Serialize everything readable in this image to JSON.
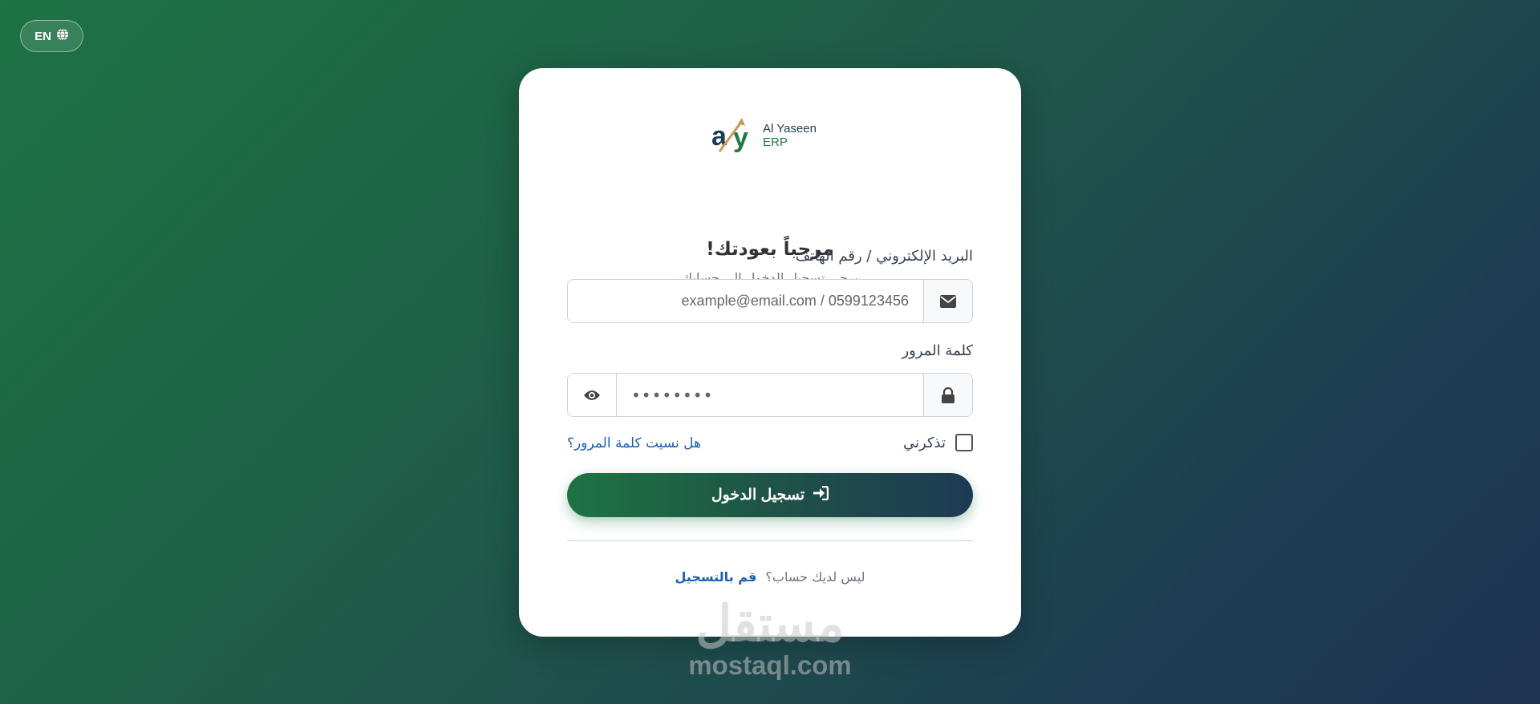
{
  "language_toggle": {
    "label": "EN",
    "icon": "globe-icon"
  },
  "logo": {
    "line1": "Al Yaseen",
    "line2": "ERP",
    "icon": "aly-logo-mark"
  },
  "header": {
    "title": "مرحباً بعودتك!",
    "subtitle": "يرجى تسجيل الدخول إلى حسابك"
  },
  "email_field": {
    "label": "البريد الإلكتروني / رقم الهاتف",
    "placeholder": "example@email.com / 0599123456",
    "icon": "envelope-icon"
  },
  "password_field": {
    "label": "كلمة المرور",
    "value_masked": "••••••••",
    "lock_icon": "lock-icon",
    "toggle_icon": "eye-icon"
  },
  "remember_me": {
    "label": "تذكرني",
    "checked": false
  },
  "forgot_password": {
    "label": "هل نسيت كلمة المرور؟"
  },
  "login_button": {
    "label": "تسجيل الدخول",
    "icon": "sign-in-icon"
  },
  "signup": {
    "prompt": "ليس لديك حساب؟",
    "link": "قم بالتسجيل"
  },
  "watermark": {
    "arabic": "مستقل",
    "url": "mostaql.com"
  },
  "colors": {
    "brand_green": "#1d7343",
    "brand_navy": "#1e3a55",
    "link_blue": "#1d5fb3"
  }
}
